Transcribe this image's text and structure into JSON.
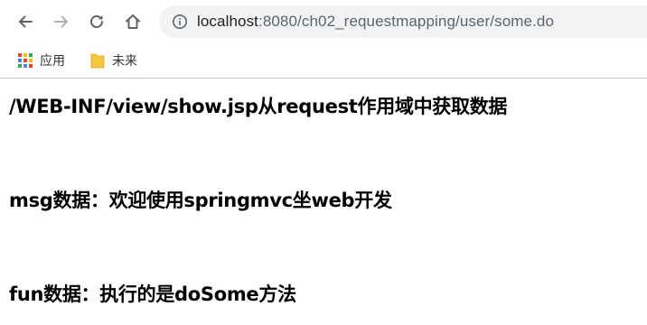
{
  "browser": {
    "url_host": "localhost",
    "url_rest": ":8080/ch02_requestmapping/user/some.do",
    "icons": {
      "back": "arrow-left-icon",
      "forward": "arrow-right-icon",
      "reload": "reload-icon",
      "home": "home-icon",
      "site_info": "info-icon"
    }
  },
  "bookmarks": [
    {
      "label": "应用",
      "icon": "apps-grid-icon"
    },
    {
      "label": "未来",
      "icon": "folder-icon"
    }
  ],
  "page": {
    "heading": "/WEB-INF/view/show.jsp从request作用域中获取数据",
    "msg_line": "msg数据：欢迎使用springmvc坐web开发",
    "fun_line": "fun数据：执行的是doSome方法"
  },
  "colors": {
    "toolbar_icon": "#5f6368",
    "omnibox_bg": "#f1f3f4",
    "folder": "#f5c842",
    "apps": [
      "#ea4335",
      "#fbbc05",
      "#34a853",
      "#4285f4"
    ]
  }
}
